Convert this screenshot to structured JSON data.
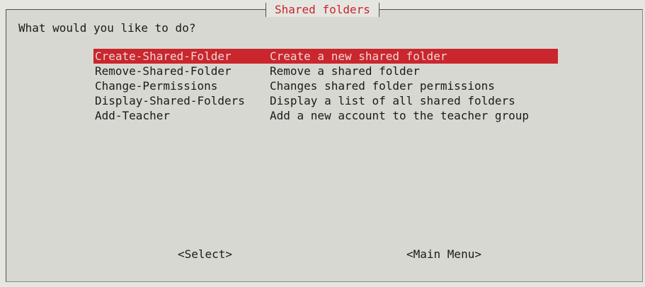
{
  "dialog": {
    "title": "Shared folders",
    "prompt": "What would you like to do?"
  },
  "menu": [
    {
      "tag": "Create-Shared-Folder",
      "description": "Create a new shared folder",
      "selected": true
    },
    {
      "tag": "Remove-Shared-Folder",
      "description": "Remove a shared folder",
      "selected": false
    },
    {
      "tag": "Change-Permissions",
      "description": "Changes shared folder permissions",
      "selected": false
    },
    {
      "tag": "Display-Shared-Folders",
      "description": "Display a list of all shared folders",
      "selected": false
    },
    {
      "tag": "Add-Teacher",
      "description": "Add a new account to the teacher group",
      "selected": false
    }
  ],
  "buttons": {
    "select": "<Select>",
    "main_menu": "<Main Menu>"
  },
  "colors": {
    "highlight": "#c9262d",
    "title_text": "#c8242a",
    "background": "#d8d8d3"
  }
}
